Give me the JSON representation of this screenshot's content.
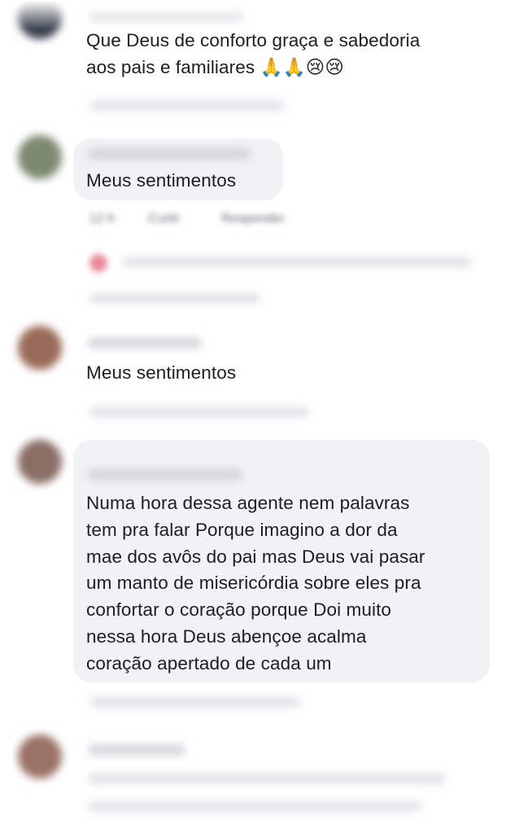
{
  "comments": [
    {
      "text": "Que Deus de conforto graça e sabedoria\naos pais e familiares 🙏🙏😢😢"
    },
    {
      "text": "Meus sentimentos"
    },
    {
      "text": "Meus sentimentos"
    },
    {
      "text": "Numa hora dessa agente nem palavras\ntem pra falar Porque imagino a dor da\nmae dos avôs do pai mas Deus vai pasar\num manto de misericórdia sobre eles pra\nconfortar o coração porque Doi muito\nnessa hora Deus abençoe acalma\ncoração apertado de cada um"
    }
  ],
  "actions": {
    "like": "Curtir",
    "reply": "Responder"
  },
  "colors": {
    "bubble": "#f0f2f5",
    "text": "#1c1e21",
    "meta": "#65676b"
  }
}
